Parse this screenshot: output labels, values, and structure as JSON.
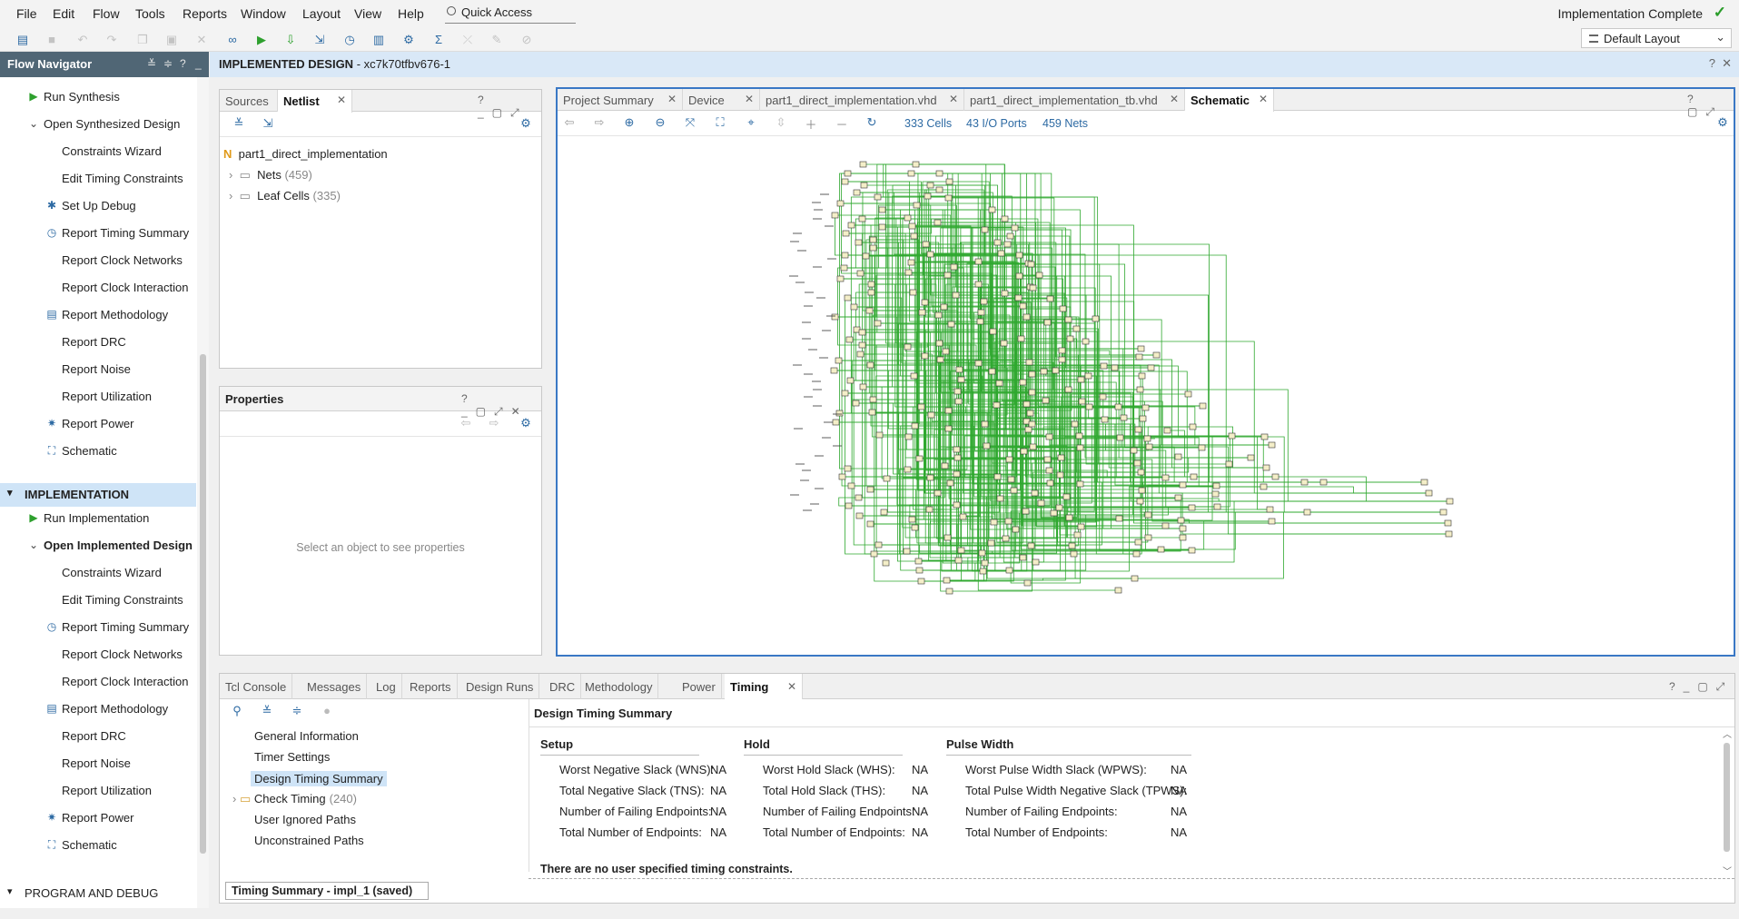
{
  "menu": [
    "File",
    "Edit",
    "Flow",
    "Tools",
    "Reports",
    "Window",
    "Layout",
    "View",
    "Help"
  ],
  "quick_access": "Quick Access",
  "status": "Implementation Complete",
  "layout_select": "Default Layout",
  "flow_navigator": {
    "title": "Flow Navigator",
    "synthesis_items": [
      {
        "label": "Run Synthesis",
        "icon": "run-icon"
      },
      {
        "label": "Open Synthesized Design",
        "icon": "expand-icon"
      },
      {
        "label": "Constraints Wizard",
        "icon": ""
      },
      {
        "label": "Edit Timing Constraints",
        "icon": ""
      },
      {
        "label": "Set Up Debug",
        "icon": "debug-icon"
      },
      {
        "label": "Report Timing Summary",
        "icon": "clock-icon"
      },
      {
        "label": "Report Clock Networks",
        "icon": ""
      },
      {
        "label": "Report Clock Interaction",
        "icon": ""
      },
      {
        "label": "Report Methodology",
        "icon": "clipboard-icon"
      },
      {
        "label": "Report DRC",
        "icon": ""
      },
      {
        "label": "Report Noise",
        "icon": ""
      },
      {
        "label": "Report Utilization",
        "icon": ""
      },
      {
        "label": "Report Power",
        "icon": "power-icon"
      },
      {
        "label": "Schematic",
        "icon": "schematic-icon"
      }
    ],
    "implementation_header": "IMPLEMENTATION",
    "implementation_items": [
      {
        "label": "Run Implementation",
        "icon": "run-icon"
      },
      {
        "label": "Open Implemented Design",
        "icon": "expand-icon"
      },
      {
        "label": "Constraints Wizard",
        "icon": ""
      },
      {
        "label": "Edit Timing Constraints",
        "icon": ""
      },
      {
        "label": "Report Timing Summary",
        "icon": "clock-icon"
      },
      {
        "label": "Report Clock Networks",
        "icon": ""
      },
      {
        "label": "Report Clock Interaction",
        "icon": ""
      },
      {
        "label": "Report Methodology",
        "icon": "clipboard-icon"
      },
      {
        "label": "Report DRC",
        "icon": ""
      },
      {
        "label": "Report Noise",
        "icon": ""
      },
      {
        "label": "Report Utilization",
        "icon": ""
      },
      {
        "label": "Report Power",
        "icon": "power-icon"
      },
      {
        "label": "Schematic",
        "icon": "schematic-icon"
      }
    ],
    "program_header": "PROGRAM AND DEBUG"
  },
  "design_bar": {
    "title": "IMPLEMENTED DESIGN",
    "part": " - xc7k70tfbv676-1"
  },
  "sources_panel": {
    "tabs": [
      "Sources",
      "Netlist"
    ],
    "root": "part1_direct_implementation",
    "nets_label": "Nets",
    "nets_count": "(459)",
    "cells_label": "Leaf Cells",
    "cells_count": "(335)"
  },
  "properties_panel": {
    "title": "Properties",
    "empty_text": "Select an object to see properties"
  },
  "main_tabs": [
    "Project Summary",
    "Device",
    "part1_direct_implementation.vhd",
    "part1_direct_implementation_tb.vhd",
    "Schematic"
  ],
  "schematic_stats": {
    "cells": "333 Cells",
    "ports": "43 I/O Ports",
    "nets": "459 Nets"
  },
  "bottom_tabs": [
    "Tcl Console",
    "Messages",
    "Log",
    "Reports",
    "Design Runs",
    "DRC",
    "Methodology",
    "Power",
    "Timing"
  ],
  "timing_tree": [
    {
      "label": "General Information",
      "count": ""
    },
    {
      "label": "Timer Settings",
      "count": ""
    },
    {
      "label": "Design Timing Summary",
      "count": ""
    },
    {
      "label": "Check Timing",
      "count": "(240)"
    },
    {
      "label": "User Ignored Paths",
      "count": ""
    },
    {
      "label": "Unconstrained Paths",
      "count": ""
    }
  ],
  "timing_title": "Design Timing Summary",
  "setup": {
    "header": "Setup",
    "rows": [
      [
        "Worst Negative Slack (WNS):",
        "NA"
      ],
      [
        "Total Negative Slack (TNS):",
        "NA"
      ],
      [
        "Number of Failing Endpoints:",
        "NA"
      ],
      [
        "Total Number of Endpoints:",
        "NA"
      ]
    ]
  },
  "hold": {
    "header": "Hold",
    "rows": [
      [
        "Worst Hold Slack (WHS):",
        "NA"
      ],
      [
        "Total Hold Slack (THS):",
        "NA"
      ],
      [
        "Number of Failing Endpoints:",
        "NA"
      ],
      [
        "Total Number of Endpoints:",
        "NA"
      ]
    ]
  },
  "pulse": {
    "header": "Pulse Width",
    "rows": [
      [
        "Worst Pulse Width Slack (WPWS):",
        "NA"
      ],
      [
        "Total Pulse Width Negative Slack (TPWS):",
        "NA"
      ],
      [
        "Number of Failing Endpoints:",
        "NA"
      ],
      [
        "Total Number of Endpoints:",
        "NA"
      ]
    ]
  },
  "timing_note": "There are no user specified timing constraints.",
  "summary_tab": "Timing Summary - impl_1 (saved)"
}
